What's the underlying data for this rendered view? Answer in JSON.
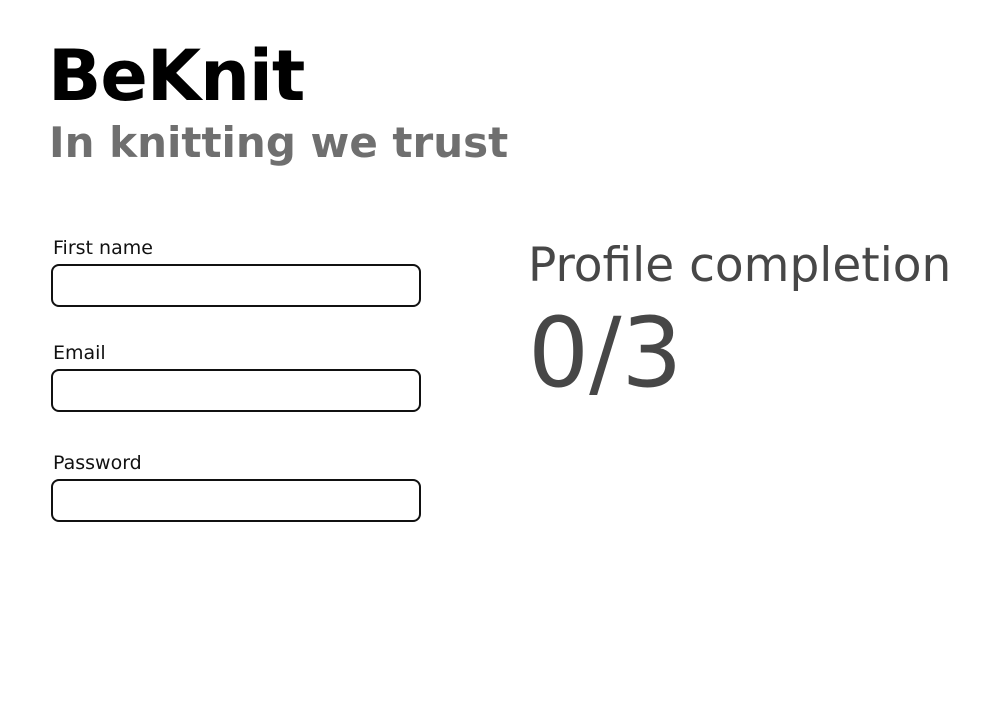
{
  "header": {
    "title": "BeKnit",
    "tagline": "In knitting we trust"
  },
  "form": {
    "first_name": {
      "label": "First name",
      "value": "",
      "placeholder": ""
    },
    "email": {
      "label": "Email",
      "value": "",
      "placeholder": ""
    },
    "password": {
      "label": "Password",
      "value": "",
      "placeholder": ""
    }
  },
  "completion": {
    "label": "Profile completion",
    "value": "0/3",
    "completed": 0,
    "total": 3
  },
  "colors": {
    "title": "#000000",
    "tagline": "#6f6f6f",
    "completion_text": "#474747",
    "input_border": "#111111"
  }
}
